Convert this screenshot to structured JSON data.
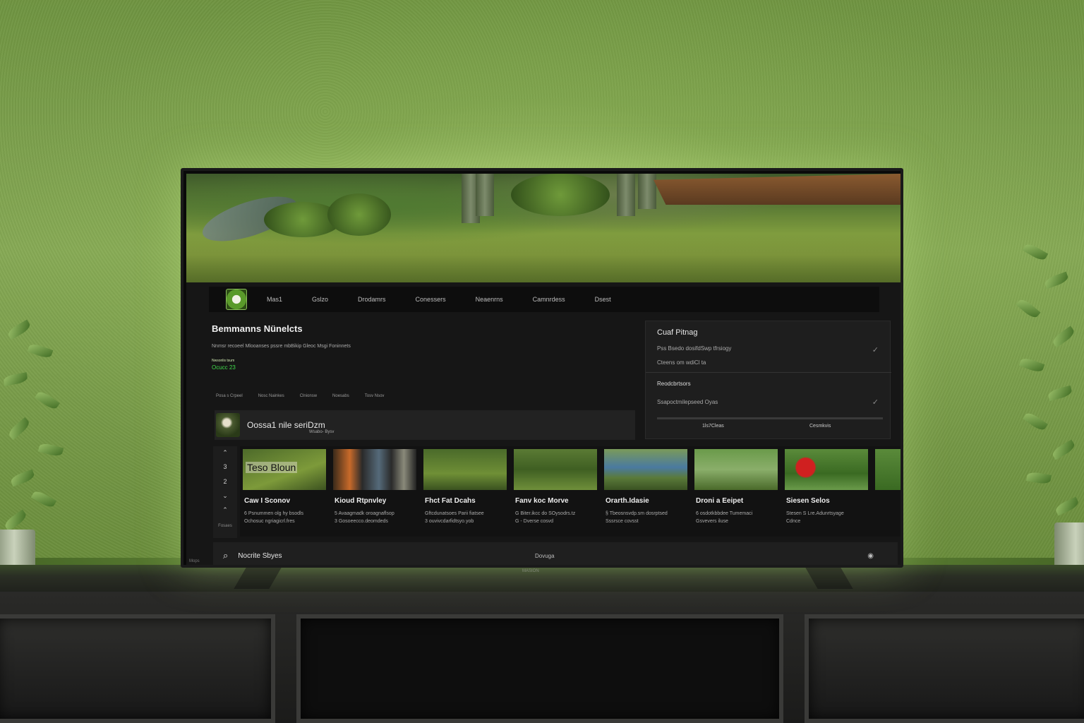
{
  "nav": {
    "items": [
      "Mas1",
      "Gslzo",
      "Drodamrs",
      "Conessers",
      "Neaenrns",
      "Camnrdess",
      "Dsest"
    ]
  },
  "hero": {
    "title": "Bemmanns Nünelcts",
    "description": "Nnmsr recoeel Mlooanses pssre mbBikip Gleoc Msgi Foninnets",
    "badge_top": "Nwsonlis tsum",
    "badge": "Ocucc 23",
    "filters": [
      "Posa s Crpeel",
      "Nosc Nainkes",
      "Clnionsw",
      "Noesabs",
      "Tosv Nsov"
    ]
  },
  "now_playing": {
    "title": "Oossa1 nile seriDzm",
    "subtitle": "Wsabo- Bysv"
  },
  "side_panel": {
    "header": "Cuaf Pitnag",
    "line1": "Pss Bsedo dosifdSwp tfrsiogy",
    "line2": "Cteens om wdiCl ta",
    "section2": "Reodcbrtsors",
    "line3": "Ssapoctmilepseed Oyas",
    "footer_left": "1ls7Cleas",
    "footer_right": "Cesmkvis"
  },
  "rail": {
    "items": [
      "⌃",
      "3",
      "2",
      "⌄",
      "⌃"
    ],
    "footer": "Fosaes"
  },
  "cards": [
    {
      "title": "Caw I Sconov",
      "line1": "6 Psnummen olg hy bsodls",
      "line2": "Ochosuc ngriagicrl.fres",
      "overlay": "Teso Bloun"
    },
    {
      "title": "Kioud Rtpnvley",
      "line1": "5 Avaagmadk oroagnaflsop",
      "line2": "3 Gosoeecco.deomdeds",
      "overlay": ""
    },
    {
      "title": "Fhct Fat Dcahs",
      "line1": "Gftcdunatsoes Parii fiatsee",
      "line2": "3 ouvivcdarfidtsyo.yob",
      "overlay": ""
    },
    {
      "title": "Fanv koc Morve",
      "line1": "G Biter.ikcc do SOysodrs.tz",
      "line2": "G - Dverse cosvd",
      "overlay": ""
    },
    {
      "title": "Orarth.Idasie",
      "line1": "§ Tbeosnsvdp.sm dosrptsed",
      "line2": "Sssrsce covsst",
      "overlay": ""
    },
    {
      "title": "Droni a Eeipet",
      "line1": "6 osdotkbbdee Tumemaci",
      "line2": "Gsvevers iluse",
      "overlay": ""
    },
    {
      "title": "Siesen Selos",
      "line1": "Stesen S Lre.Adunrtsyage",
      "line2": "Cdnce",
      "overlay": ""
    }
  ],
  "bottom_bar": {
    "left_label": "Nocrite Sbyes",
    "center_label": "Dovuga",
    "corner": "Mops"
  },
  "tv_brand": "MASION"
}
